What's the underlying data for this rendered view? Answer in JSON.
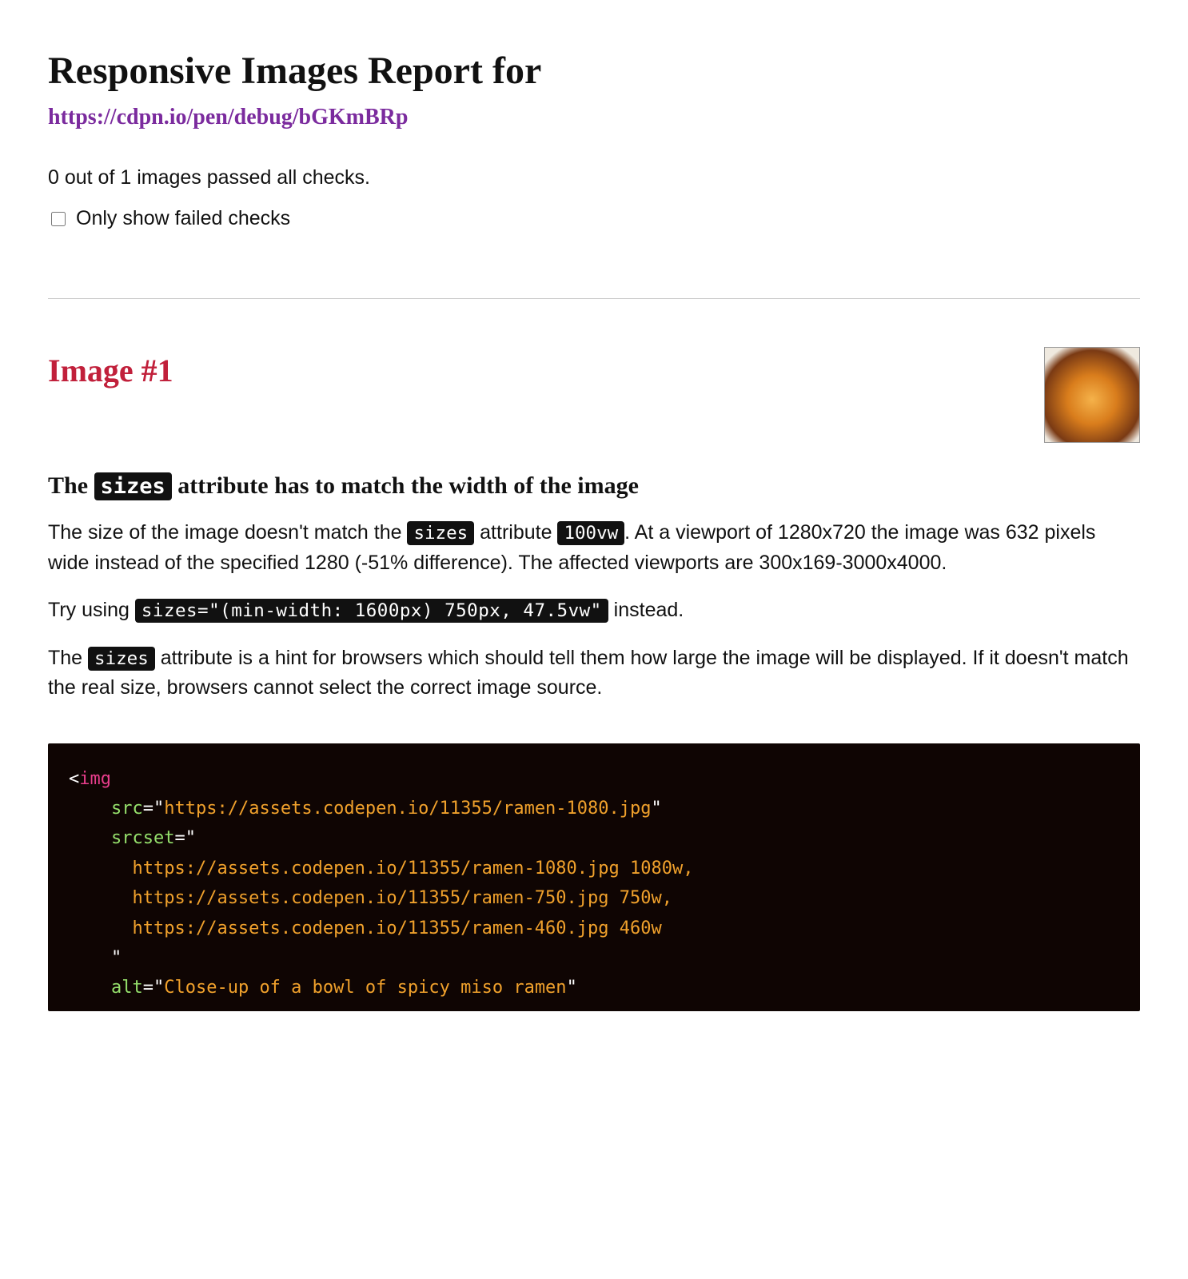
{
  "title": "Responsive Images Report for",
  "url": "https://cdpn.io/pen/debug/bGKmBRp",
  "summary": "0 out of 1 images passed all checks.",
  "filter_label": "Only show failed checks",
  "image": {
    "heading": "Image #1",
    "check_title_pre": "The ",
    "check_title_code": "sizes",
    "check_title_post": " attribute has to match the width of the image",
    "p1_a": "The size of the image doesn't match the ",
    "p1_code1": "sizes",
    "p1_b": " attribute ",
    "p1_code2": "100vw",
    "p1_c": ". At a viewport of 1280x720 the image was 632 pixels wide instead of the specified 1280 (-51% difference). The affected viewports are 300x169-3000x4000.",
    "p2_a": "Try using ",
    "p2_code": "sizes=\"(min-width: 1600px) 750px, 47.5vw\"",
    "p2_b": " instead.",
    "p3_a": "The ",
    "p3_code": "sizes",
    "p3_b": " attribute is a hint for browsers which should tell them how large the image will be displayed. If it doesn't match the real size, browsers cannot select the correct image source."
  },
  "code": {
    "l1_open": "<",
    "l1_tag": "img",
    "l2_attr": "src",
    "l2_eq": "=\"",
    "l2_val": "https://assets.codepen.io/11355/ramen-1080.jpg",
    "l2_close": "\"",
    "l3_attr": "srcset",
    "l3_eq": "=\"",
    "l4": "https://assets.codepen.io/11355/ramen-1080.jpg 1080w,",
    "l5": "https://assets.codepen.io/11355/ramen-750.jpg 750w,",
    "l6": "https://assets.codepen.io/11355/ramen-460.jpg 460w",
    "l7_close": "\"",
    "l8_attr": "alt",
    "l8_eq": "=\"",
    "l8_val": "Close-up of a bowl of spicy miso ramen",
    "l8_close": "\""
  }
}
